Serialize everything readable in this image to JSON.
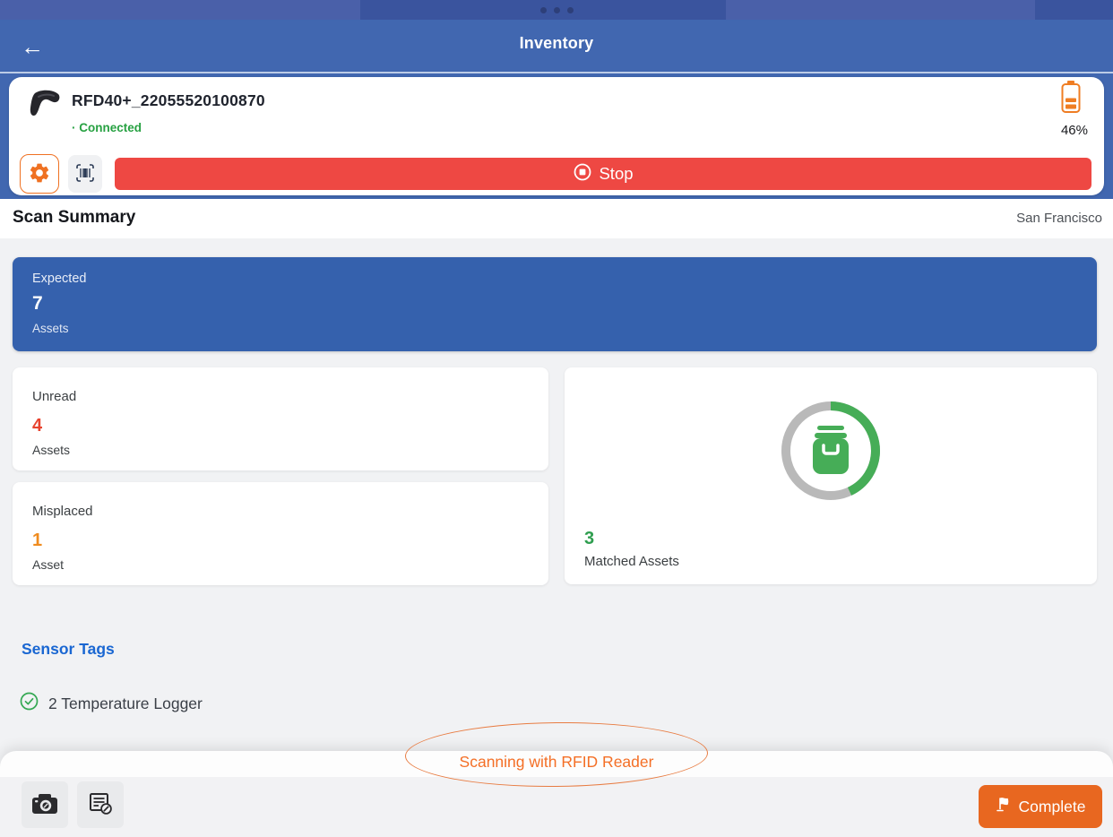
{
  "icons": {
    "back": "←"
  },
  "header": {
    "title": "Inventory"
  },
  "device": {
    "name": "RFD40+_22055520100870",
    "status": "· Connected",
    "battery_percent": "46%",
    "stop_label": "Stop"
  },
  "scan_summary": {
    "title": "Scan Summary",
    "location": "San Francisco",
    "cards": {
      "expected": {
        "label": "Expected",
        "value": "7",
        "unit": "Assets"
      },
      "unread": {
        "label": "Unread",
        "value": "4",
        "unit": "Assets"
      },
      "misplaced": {
        "label": "Misplaced",
        "value": "1",
        "unit": "Asset"
      },
      "matched": {
        "value": "3",
        "label": "Matched Assets",
        "progress_fraction": 0.43
      }
    }
  },
  "sensor_tags": {
    "title": "Sensor Tags",
    "items": [
      {
        "text": "2 Temperature Logger"
      }
    ]
  },
  "annotation": {
    "text": "Scanning with RFID Reader"
  },
  "footer": {
    "complete_label": "Complete"
  },
  "colors": {
    "statusbar_blue": "#3a549e",
    "header_blue": "#4167b0",
    "expected_blue": "#3561ad",
    "stop_red": "#ee4843",
    "accent_orange": "#e86720",
    "connected_green": "#27a142",
    "matched_green": "#2f9e4f",
    "ring_green": "#46ad57",
    "ring_gray": "#b9b9b9",
    "unread_red": "#e8432e",
    "misplaced_orange": "#ef8b1e",
    "link_blue": "#1a67d2"
  }
}
